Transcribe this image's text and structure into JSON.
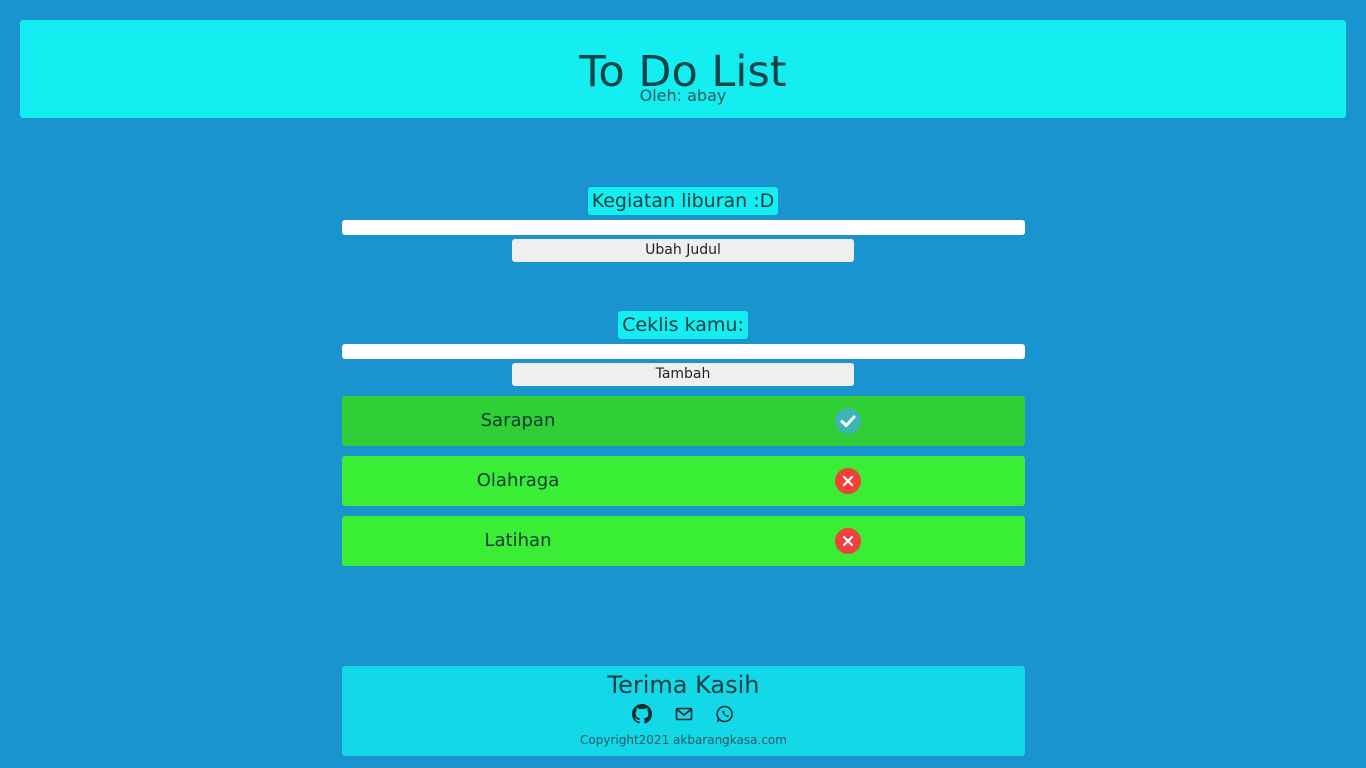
{
  "header": {
    "title": "To Do List",
    "author": "Oleh: abay"
  },
  "title_section": {
    "label": "Kegiatan liburan :D",
    "input_value": "",
    "button_label": "Ubah Judul"
  },
  "checklist_section": {
    "label": "Ceklis kamu:",
    "input_value": "",
    "button_label": "Tambah"
  },
  "todos": [
    {
      "label": "Sarapan",
      "done": true,
      "bg": "#31cf36",
      "icon": "check-circle-icon"
    },
    {
      "label": "Olahraga",
      "done": false,
      "bg": "#39ee34",
      "icon": "x-circle-icon"
    },
    {
      "label": "Latihan",
      "done": false,
      "bg": "#39ee34",
      "icon": "x-circle-icon"
    }
  ],
  "footer": {
    "title": "Terima Kasih",
    "icons": [
      "github-icon",
      "mail-icon",
      "whatsapp-icon"
    ],
    "copyright": "Copyright2021 akbarangkasa.com"
  },
  "colors": {
    "page_bg": "#1994cf",
    "header_bg": "#15eef0",
    "footer_bg": "#12d8e8",
    "done_icon": "#3fb4b4",
    "undone_icon": "#f0413b"
  }
}
